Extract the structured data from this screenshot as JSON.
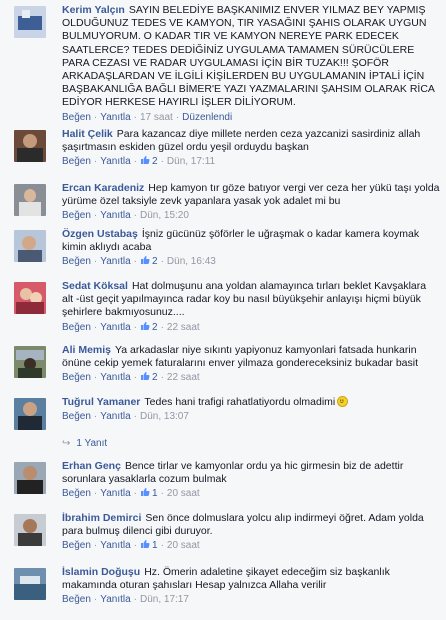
{
  "actions": {
    "like": "Beğen",
    "reply": "Yanıtla",
    "edited": "Düzenlendi"
  },
  "comments": [
    {
      "author": "Kerim Yalçın",
      "text": "SAYIN BELEDİYE BAŞKANIMIZ ENVER YILMAZ BEY YAPMIŞ OLDUĞUNUZ TEDES VE KAMYON, TIR YASAĞINI ŞAHIS OLARAK UYGUN BULMUYORUM. O KADAR TIR VE KAMYON NEREYE PARK EDECEK SAATLERCE? TEDES DEDİĞİNİZ UYGULAMA TAMAMEN SÜRÜCÜLERE PARA CEZASI VE RADAR UYGULAMASI İÇİN BİR TUZAK!!! ŞOFÖR ARKADAŞLARDAN VE İLGİLİ KİŞİLERDEN BU UYGULAMANIN İPTALİ İÇİN BAŞBAKANLIĞA BAĞLI BİMER'E YAZI YAZMALARINI ŞAHSIM OLARAK RİCA EDİYOR HERKESE HAYIRLI İŞLER DİLİYORUM.",
      "likes": "",
      "time": "17 saat",
      "edited": true
    },
    {
      "author": "Halit Çelik",
      "text": "Para kazancaz diye millete nerden ceza yazcanizi sasirdiniz allah şaşırtmasın eskiden güzel ordu yeşil orduydu başkan",
      "likes": "2",
      "time": "Dün, 17:11"
    },
    {
      "author": "Ercan Karadeniz",
      "text": "Hep kamyon tır göze batıyor vergi ver ceza her yükü taşı yolda yürüme özel taksiyle zevk yapanlara yasak yok adalet mi bu",
      "likes": "",
      "time": "Dün, 15:20"
    },
    {
      "author": "Özgen Ustabaş",
      "text": "İşniz gücünüz şöförler le uğraşmak o kadar kamera koymak kimin aklıydı acaba",
      "likes": "2",
      "time": "Dün, 16:43"
    },
    {
      "author": "Sedat Köksal",
      "text": "Hat dolmuşunu ana yoldan alamayınca tırları beklet Kavşaklara alt -üst geçit yapılmayınca radar koy bu nasıl büyükşehir anlayışı hiçmi büyük şehirlere bakmıyosunuz....",
      "likes": "2",
      "time": "22 saat"
    },
    {
      "author": "Ali Memiş",
      "text": "Ya arkadaslar niye sıkıntı yapiyonuz kamyonlari fatsada hunkarin önüne cekip yemek faturalarını enver yilmaza gondereceksiniz bukadar basit",
      "likes": "2",
      "time": "22 saat"
    },
    {
      "author": "Tuğrul Yamaner",
      "text": "Tedes hani trafigi rahatlatiyordu olmadimi",
      "likes": "",
      "time": "Dün, 13:07",
      "emoji": "smile-emoji"
    },
    {
      "author": "Erhan Genç",
      "text": "Bence tirlar ve kamyonlar ordu ya hic girmesin biz de adettir sorunlara yasaklarla cozum bulmak",
      "likes": "1",
      "time": "20 saat"
    },
    {
      "author": "İbrahim Demirci",
      "text": "Sen önce dolmuslara yolcu alıp indirmeyi öğret. Adam yolda para bulmuş dilenci gibi duruyor.",
      "likes": "1",
      "time": "20 saat"
    },
    {
      "author": "İslamin Doğuşu",
      "text": "Hz. Ömerin adaletine şikayet edeceğim siz başkanlık makamında oturan şahısları Hesap yalnızca Allaha verilir",
      "likes": "",
      "time": "Dün, 17:17"
    }
  ],
  "reply_count_label": "1 Yanıt",
  "colors": {
    "link": "#3b5998",
    "meta": "#9197a3",
    "background": "#f6f7f9"
  }
}
